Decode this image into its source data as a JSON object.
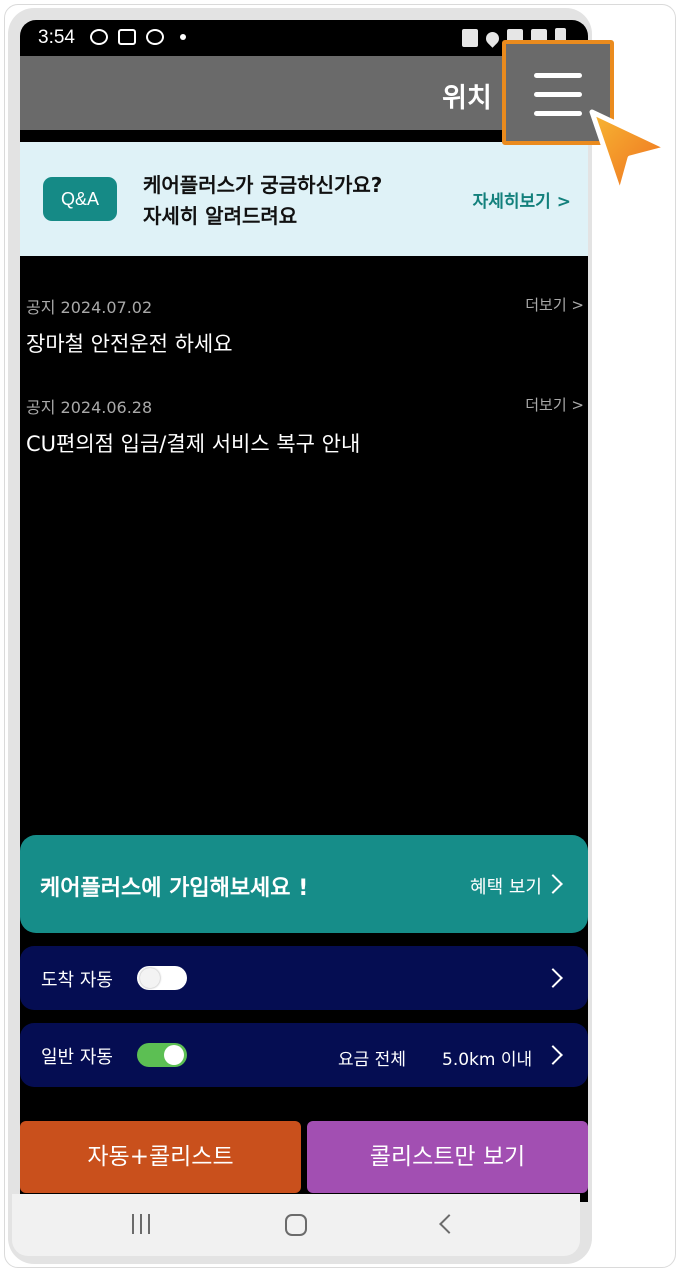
{
  "status_bar": {
    "time": "3:54"
  },
  "header": {
    "title": "위치 :",
    "menu_icon": "hamburger-menu-icon"
  },
  "qa_banner": {
    "badge": "Q&A",
    "line1": "케어플러스가 궁금하신가요?",
    "line2": "자세히 알려드려요",
    "more": "자세히보기 >"
  },
  "notices": [
    {
      "meta": "공지 2024.07.02",
      "title": "장마철 안전운전 하세요",
      "more": "더보기 >"
    },
    {
      "meta": "공지 2024.06.28",
      "title": "CU편의점 입금/결제 서비스 복구 안내",
      "more": "더보기 >"
    }
  ],
  "join_banner": {
    "title": "케어플러스에 가입해보세요 !",
    "more": "혜택 보기"
  },
  "rows": [
    {
      "label": "도착 자동",
      "toggle_on": false
    },
    {
      "label": "일반 자동",
      "toggle_on": true,
      "fee": "요금 전체",
      "distance": "5.0km 이내"
    }
  ],
  "buttons": {
    "auto_list": "자동+콜리스트",
    "list_only": "콜리스트만 보기"
  },
  "colors": {
    "accent_teal": "#168d89",
    "navy": "#050d52",
    "orange_button": "#c9501c",
    "purple_button": "#a24fb2",
    "highlight": "#ea8b1e",
    "toggle_on": "#5cbf53"
  }
}
